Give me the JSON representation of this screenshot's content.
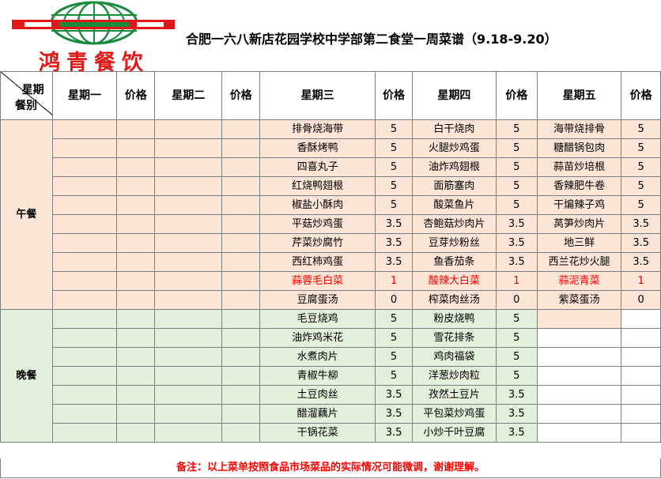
{
  "logo": {
    "text": "鸿青餐饮",
    "colors": {
      "green": "#1a8a3c",
      "red": "#e01818"
    }
  },
  "title": "合肥一六八新店花园学校中学部第二食堂一周菜谱（9.18-9.20）",
  "header": {
    "corner_top": "星期",
    "corner_bottom": "餐别",
    "columns": [
      "星期一",
      "价格",
      "星期二",
      "价格",
      "星期三",
      "价格",
      "星期四",
      "价格",
      "星期五",
      "价格"
    ]
  },
  "meals": {
    "lunch": "午餐",
    "dinner": "晚餐"
  },
  "lunch_rows": [
    {
      "wed": "排骨烧海带",
      "wed_p": "5",
      "thu": "白干烧肉",
      "thu_p": "5",
      "fri": "海带烧排骨",
      "fri_p": "5"
    },
    {
      "wed": "香酥烤鸭",
      "wed_p": "5",
      "thu": "火腿炒鸡蛋",
      "thu_p": "5",
      "fri": "糖醋锅包肉",
      "fri_p": "5"
    },
    {
      "wed": "四喜丸子",
      "wed_p": "5",
      "thu": "油炸鸡翅根",
      "thu_p": "5",
      "fri": "蒜苗炒培根",
      "fri_p": "5"
    },
    {
      "wed": "红烧鸭翅根",
      "wed_p": "5",
      "thu": "面筋塞肉",
      "thu_p": "5",
      "fri": "香辣肥牛卷",
      "fri_p": "5"
    },
    {
      "wed": "椒盐小酥肉",
      "wed_p": "5",
      "thu": "酸菜鱼片",
      "thu_p": "5",
      "fri": "干煸辣子鸡",
      "fri_p": "5"
    },
    {
      "wed": "平菇炒鸡蛋",
      "wed_p": "3.5",
      "thu": "杏鲍菇炒肉片",
      "thu_p": "3.5",
      "fri": "莴笋炒肉片",
      "fri_p": "3.5"
    },
    {
      "wed": "芹菜炒腐竹",
      "wed_p": "3.5",
      "thu": "豆芽炒粉丝",
      "thu_p": "3.5",
      "fri": "地三鲜",
      "fri_p": "3.5"
    },
    {
      "wed": "西红柿鸡蛋",
      "wed_p": "3.5",
      "thu": "鱼香茄条",
      "thu_p": "3.5",
      "fri": "西兰花炒火腿",
      "fri_p": "3.5"
    },
    {
      "wed": "蒜蓉毛白菜",
      "wed_p": "1",
      "thu": "酸辣大白菜",
      "thu_p": "1",
      "fri": "蒜泥青菜",
      "fri_p": "1",
      "red": true
    },
    {
      "wed": "豆腐蛋汤",
      "wed_p": "0",
      "thu": "榨菜肉丝汤",
      "thu_p": "0",
      "fri": "紫菜蛋汤",
      "fri_p": "0"
    }
  ],
  "dinner_rows": [
    {
      "wed": "毛豆烧鸡",
      "wed_p": "5",
      "thu": "粉皮烧鸭",
      "thu_p": "5"
    },
    {
      "wed": "油炸鸡米花",
      "wed_p": "5",
      "thu": "雪花排条",
      "thu_p": "5"
    },
    {
      "wed": "水煮肉片",
      "wed_p": "5",
      "thu": "鸡肉福袋",
      "thu_p": "5"
    },
    {
      "wed": "青椒牛柳",
      "wed_p": "5",
      "thu": "洋葱炒肉粒",
      "thu_p": "5"
    },
    {
      "wed": "土豆肉丝",
      "wed_p": "3.5",
      "thu": "孜然土豆片",
      "thu_p": "3.5"
    },
    {
      "wed": "醋溜藕片",
      "wed_p": "3.5",
      "thu": "平包菜炒鸡蛋",
      "thu_p": "3.5"
    },
    {
      "wed": "干锅花菜",
      "wed_p": "3.5",
      "thu": "小炒千叶豆腐",
      "thu_p": "3.5"
    }
  ],
  "footnote": "备注：以上菜单按照食品市场菜品的实际情况可能微调，谢谢理解。"
}
